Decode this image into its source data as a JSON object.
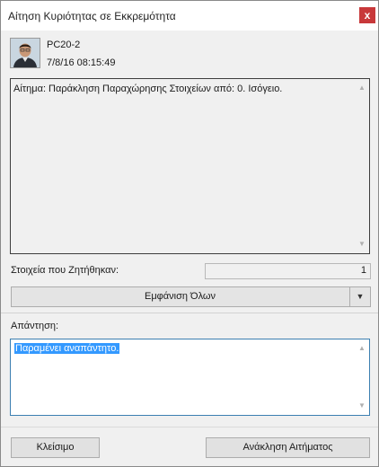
{
  "window": {
    "title": "Αίτηση Κυριότητας σε Εκκρεμότητα",
    "close_label": "x"
  },
  "request": {
    "user": "PC20-2",
    "timestamp": "7/8/16 08:15:49",
    "message": "Αίτημα: Παράκληση Παραχώρησης Στοιχείων από: 0. Ισόγειο."
  },
  "items": {
    "label": "Στοιχεία που Ζητήθηκαν:",
    "count": "1"
  },
  "show_all": {
    "label": "Εμφάνιση Όλων"
  },
  "response": {
    "label": "Απάντηση:",
    "value": "Παραμένει αναπάντητο."
  },
  "buttons": {
    "close": "Κλείσιμο",
    "revoke": "Ανάκληση Αιτήματος"
  },
  "icons": {
    "close": "close-icon",
    "avatar": "user-avatar",
    "scroll_up": "scroll-up-icon",
    "scroll_down": "scroll-down-icon",
    "dropdown": "chevron-down-icon"
  },
  "colors": {
    "close_button": "#c8383a",
    "selection": "#3399ff",
    "focus_border": "#3c7fb1"
  }
}
